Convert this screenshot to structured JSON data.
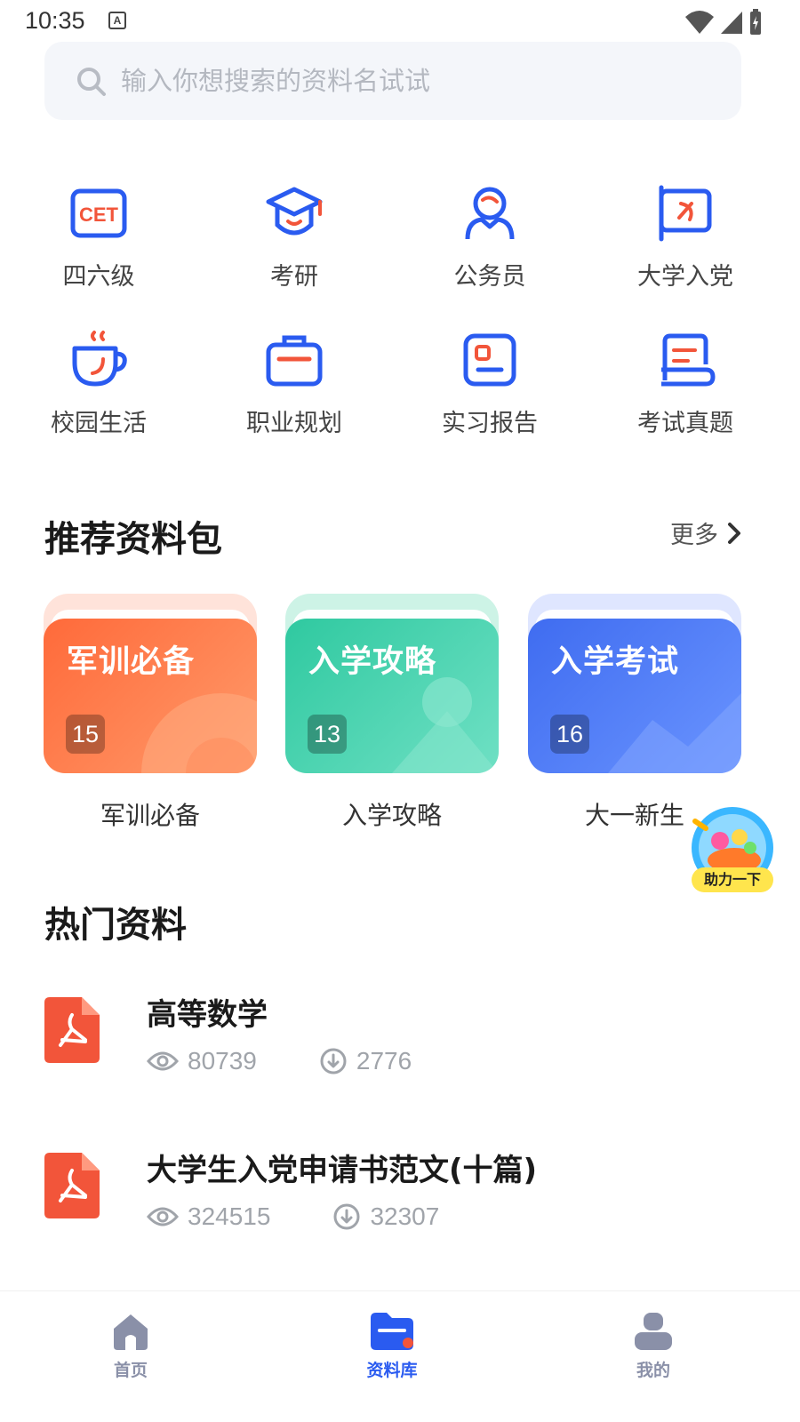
{
  "status_bar": {
    "time": "10:35",
    "a_badge": "A"
  },
  "search": {
    "placeholder": "输入你想搜索的资料名试试"
  },
  "categories": [
    {
      "label": "四六级",
      "icon": "cet-icon",
      "icon_text": "CET"
    },
    {
      "label": "考研",
      "icon": "graduation-cap-icon"
    },
    {
      "label": "公务员",
      "icon": "person-icon"
    },
    {
      "label": "大学入党",
      "icon": "party-flag-icon"
    },
    {
      "label": "校园生活",
      "icon": "coffee-cup-icon"
    },
    {
      "label": "职业规划",
      "icon": "briefcase-icon"
    },
    {
      "label": "实习报告",
      "icon": "report-card-icon"
    },
    {
      "label": "考试真题",
      "icon": "exam-paper-icon"
    }
  ],
  "recommend": {
    "title": "推荐资料包",
    "more": "更多",
    "packs": [
      {
        "title": "军训必备",
        "count": "15",
        "caption": "军训必备",
        "color": "#ff7a45"
      },
      {
        "title": "入学攻略",
        "count": "13",
        "caption": "入学攻略",
        "color": "#3ccfa8"
      },
      {
        "title": "入学考试",
        "count": "16",
        "caption": "大一新生",
        "color": "#4a7dff"
      }
    ]
  },
  "float_badge": {
    "label": "助力一下"
  },
  "hot": {
    "title": "热门资料",
    "items": [
      {
        "title": "高等数学",
        "views": "80739",
        "downloads": "2776"
      },
      {
        "title": "大学生入党申请书范文(十篇)",
        "views": "324515",
        "downloads": "32307"
      }
    ]
  },
  "bottom_nav": {
    "items": [
      {
        "label": "首页",
        "active": false
      },
      {
        "label": "资料库",
        "active": true
      },
      {
        "label": "我的",
        "active": false
      }
    ],
    "active_color": "#2a5bf0",
    "inactive_color": "#8a90a8"
  },
  "colors": {
    "accent": "#2a5bf0",
    "pdf_red": "#f2553a"
  }
}
